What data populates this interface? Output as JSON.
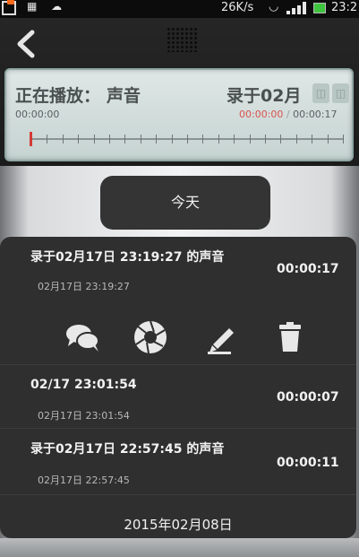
{
  "statusbar": {
    "speed": "26K/s",
    "clock": "23:2"
  },
  "player": {
    "now_playing_label": "正在播放：",
    "now_playing_title": "​声音",
    "recording_title": "录于02月",
    "elapsed_left": "00:00:00",
    "elapsed_current": "00:00:00",
    "separator": " / ",
    "duration": "00:00:17",
    "progress_fraction": 0.0
  },
  "today_button": "今天",
  "recordings": [
    {
      "title": "录于02月17日 23:19:27 的声音",
      "timestamp": "02月17日 23:19:27",
      "duration": "00:00:17"
    },
    {
      "title": "02/17 23:01:54",
      "timestamp": "02月17日 23:01:54",
      "duration": "00:00:07"
    },
    {
      "title": "录于02月17日 22:57:45 的声音",
      "timestamp": "02月17日 22:57:45",
      "duration": "00:00:11"
    }
  ],
  "actions": [
    {
      "name": "share",
      "icon": "chat-bubbles-icon"
    },
    {
      "name": "settings",
      "icon": "aperture-icon"
    },
    {
      "name": "rename",
      "icon": "pencil-icon"
    },
    {
      "name": "delete",
      "icon": "trash-icon"
    }
  ],
  "footer_date": "2015年02月08日",
  "colors": {
    "accent_red": "#d9534f",
    "list_bg": "#2f2f2f",
    "player_bg": "#dfe7e6"
  }
}
